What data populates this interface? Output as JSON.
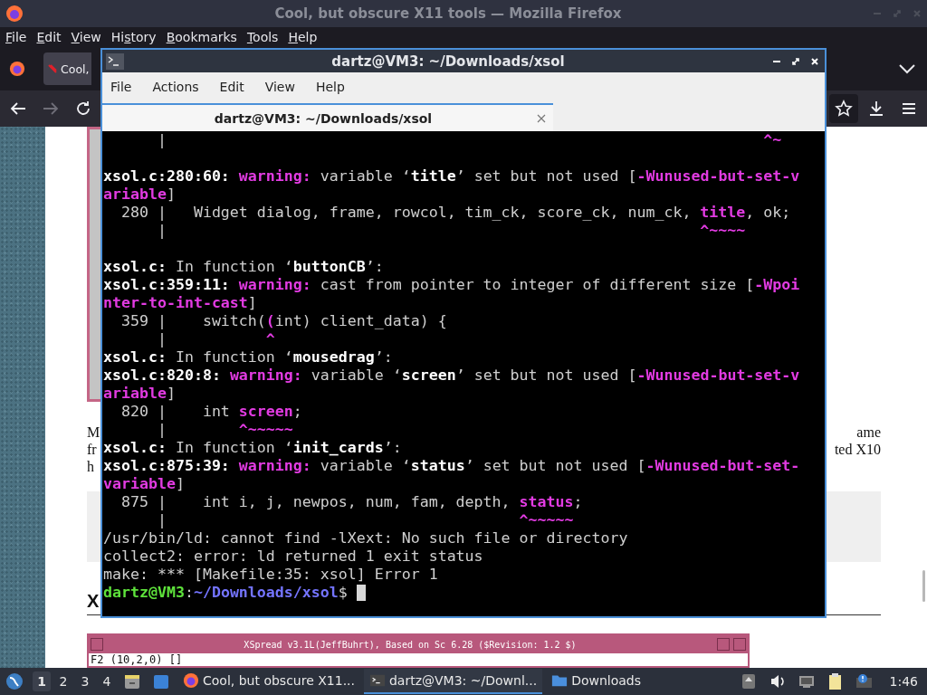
{
  "browser": {
    "title": "Cool, but obscure X11 tools — Mozilla Firefox",
    "menu": [
      {
        "key": "F",
        "post": "ile"
      },
      {
        "key": "E",
        "post": "dit"
      },
      {
        "key": "V",
        "post": "iew"
      },
      {
        "pre": "Hi",
        "key": "s",
        "post": "tory"
      },
      {
        "key": "B",
        "post": "ookmarks"
      },
      {
        "key": "T",
        "post": "ools"
      },
      {
        "key": "H",
        "post": "elp"
      }
    ],
    "tabs": [
      {
        "label": "Cool,",
        "selected": true
      }
    ]
  },
  "page": {
    "paragraph_left": [
      "M",
      "fr",
      "h"
    ],
    "paragraph_right": [
      "ame",
      "ted X10"
    ],
    "heading": "X",
    "xspread": {
      "title": "XSpread v3.1L(JeffBuhrt), Based on Sc 6.28 ($Revision: 1.2 $)",
      "status": "F2 (10,2,0) []"
    }
  },
  "terminal": {
    "title": "dartz@VM3: ~/Downloads/xsol",
    "menu": [
      "File",
      "Actions",
      "Edit",
      "View",
      "Help"
    ],
    "tabs": [
      {
        "label": "dartz@VM3: ~/Downloads/xsol",
        "selected": true
      }
    ],
    "lines": [
      {
        "kind": "text",
        "segments": [
          {
            "text": "      |                                                                  ",
            "kind": "plain"
          },
          {
            "text": "^~",
            "kind": "highlight"
          }
        ]
      },
      {
        "kind": "blank"
      },
      {
        "kind": "text",
        "segments": [
          {
            "text": "xsol.c:280:60: ",
            "kind": "bold"
          },
          {
            "text": "warning:",
            "kind": "highlight"
          },
          {
            "text": " variable ‘",
            "kind": "plain"
          },
          {
            "text": "title",
            "kind": "bold"
          },
          {
            "text": "’ set but not used [",
            "kind": "plain"
          },
          {
            "text": "-Wunused-but-set-v",
            "kind": "highlight"
          }
        ]
      },
      {
        "kind": "text",
        "segments": [
          {
            "text": "ariable",
            "kind": "highlight"
          },
          {
            "text": "]",
            "kind": "plain"
          }
        ]
      },
      {
        "kind": "text",
        "segments": [
          {
            "text": "  280 |   Widget dialog, frame, rowcol, tim_ck, score_ck, num_ck, ",
            "kind": "plain"
          },
          {
            "text": "title",
            "kind": "highlight"
          },
          {
            "text": ", ok;",
            "kind": "plain"
          }
        ]
      },
      {
        "kind": "text",
        "segments": [
          {
            "text": "      |                                                           ",
            "kind": "plain"
          },
          {
            "text": "^~~~~",
            "kind": "highlight"
          }
        ]
      },
      {
        "kind": "blank"
      },
      {
        "kind": "text",
        "segments": [
          {
            "text": "xsol.c:",
            "kind": "bold"
          },
          {
            "text": " In function ‘",
            "kind": "plain"
          },
          {
            "text": "buttonCB",
            "kind": "bold"
          },
          {
            "text": "’:",
            "kind": "plain"
          }
        ]
      },
      {
        "kind": "text",
        "segments": [
          {
            "text": "xsol.c:359:11: ",
            "kind": "bold"
          },
          {
            "text": "warning:",
            "kind": "highlight"
          },
          {
            "text": " cast from pointer to integer of different size [",
            "kind": "plain"
          },
          {
            "text": "-Wpoi",
            "kind": "highlight"
          }
        ]
      },
      {
        "kind": "text",
        "segments": [
          {
            "text": "nter-to-int-cast",
            "kind": "highlight"
          },
          {
            "text": "]",
            "kind": "plain"
          }
        ]
      },
      {
        "kind": "text",
        "segments": [
          {
            "text": "  359 |    switch(",
            "kind": "plain"
          },
          {
            "text": "(",
            "kind": "highlight"
          },
          {
            "text": "int) client_data) {",
            "kind": "plain"
          }
        ]
      },
      {
        "kind": "text",
        "segments": [
          {
            "text": "      |           ",
            "kind": "plain"
          },
          {
            "text": "^",
            "kind": "highlight"
          }
        ]
      },
      {
        "kind": "text",
        "segments": [
          {
            "text": "xsol.c:",
            "kind": "bold"
          },
          {
            "text": " In function ‘",
            "kind": "plain"
          },
          {
            "text": "mousedrag",
            "kind": "bold"
          },
          {
            "text": "’:",
            "kind": "plain"
          }
        ]
      },
      {
        "kind": "text",
        "segments": [
          {
            "text": "xsol.c:820:8: ",
            "kind": "bold"
          },
          {
            "text": "warning:",
            "kind": "highlight"
          },
          {
            "text": " variable ‘",
            "kind": "plain"
          },
          {
            "text": "screen",
            "kind": "bold"
          },
          {
            "text": "’ set but not used [",
            "kind": "plain"
          },
          {
            "text": "-Wunused-but-set-v",
            "kind": "highlight"
          }
        ]
      },
      {
        "kind": "text",
        "segments": [
          {
            "text": "ariable",
            "kind": "highlight"
          },
          {
            "text": "]",
            "kind": "plain"
          }
        ]
      },
      {
        "kind": "text",
        "segments": [
          {
            "text": "  820 |    int ",
            "kind": "plain"
          },
          {
            "text": "screen",
            "kind": "highlight"
          },
          {
            "text": ";",
            "kind": "plain"
          }
        ]
      },
      {
        "kind": "text",
        "segments": [
          {
            "text": "      |        ",
            "kind": "plain"
          },
          {
            "text": "^~~~~~",
            "kind": "highlight"
          }
        ]
      },
      {
        "kind": "text",
        "segments": [
          {
            "text": "xsol.c:",
            "kind": "bold"
          },
          {
            "text": " In function ‘",
            "kind": "plain"
          },
          {
            "text": "init_cards",
            "kind": "bold"
          },
          {
            "text": "’:",
            "kind": "plain"
          }
        ]
      },
      {
        "kind": "text",
        "segments": [
          {
            "text": "xsol.c:875:39: ",
            "kind": "bold"
          },
          {
            "text": "warning:",
            "kind": "highlight"
          },
          {
            "text": " variable ‘",
            "kind": "plain"
          },
          {
            "text": "status",
            "kind": "bold"
          },
          {
            "text": "’ set but not used [",
            "kind": "plain"
          },
          {
            "text": "-Wunused-but-set-",
            "kind": "highlight"
          }
        ]
      },
      {
        "kind": "text",
        "segments": [
          {
            "text": "variable",
            "kind": "highlight"
          },
          {
            "text": "]",
            "kind": "plain"
          }
        ]
      },
      {
        "kind": "text",
        "segments": [
          {
            "text": "  875 |    int i, j, newpos, num, fam, depth, ",
            "kind": "plain"
          },
          {
            "text": "status",
            "kind": "highlight"
          },
          {
            "text": ";",
            "kind": "plain"
          }
        ]
      },
      {
        "kind": "text",
        "segments": [
          {
            "text": "      |                                       ",
            "kind": "plain"
          },
          {
            "text": "^~~~~~",
            "kind": "highlight"
          }
        ]
      },
      {
        "kind": "text",
        "segments": [
          {
            "text": "/usr/bin/ld: cannot find -lXext: No such file or directory",
            "kind": "plain"
          }
        ]
      },
      {
        "kind": "text",
        "segments": [
          {
            "text": "collect2: error: ld returned 1 exit status",
            "kind": "plain"
          }
        ]
      },
      {
        "kind": "text",
        "segments": [
          {
            "text": "make: *** [Makefile:35: xsol] Error 1",
            "kind": "plain"
          }
        ]
      },
      {
        "kind": "prompt",
        "segments": [
          {
            "text": "dartz@VM3",
            "kind": "user"
          },
          {
            "text": ":",
            "kind": "plain"
          },
          {
            "text": "~/Downloads/xsol",
            "kind": "path"
          },
          {
            "text": "$ ",
            "kind": "plain"
          }
        ]
      }
    ]
  },
  "taskbar": {
    "workspaces": [
      {
        "label": "1",
        "selected": true
      },
      {
        "label": "2",
        "selected": false
      },
      {
        "label": "3",
        "selected": false
      },
      {
        "label": "4",
        "selected": false
      }
    ],
    "tasks": [
      {
        "kind": "firefox",
        "label": "Cool, but obscure X11...",
        "selected": false
      },
      {
        "kind": "terminal",
        "label": "dartz@VM3: ~/Downl...",
        "selected": true
      },
      {
        "kind": "folder",
        "label": "Downloads",
        "selected": false
      }
    ],
    "clock": "1:46"
  }
}
